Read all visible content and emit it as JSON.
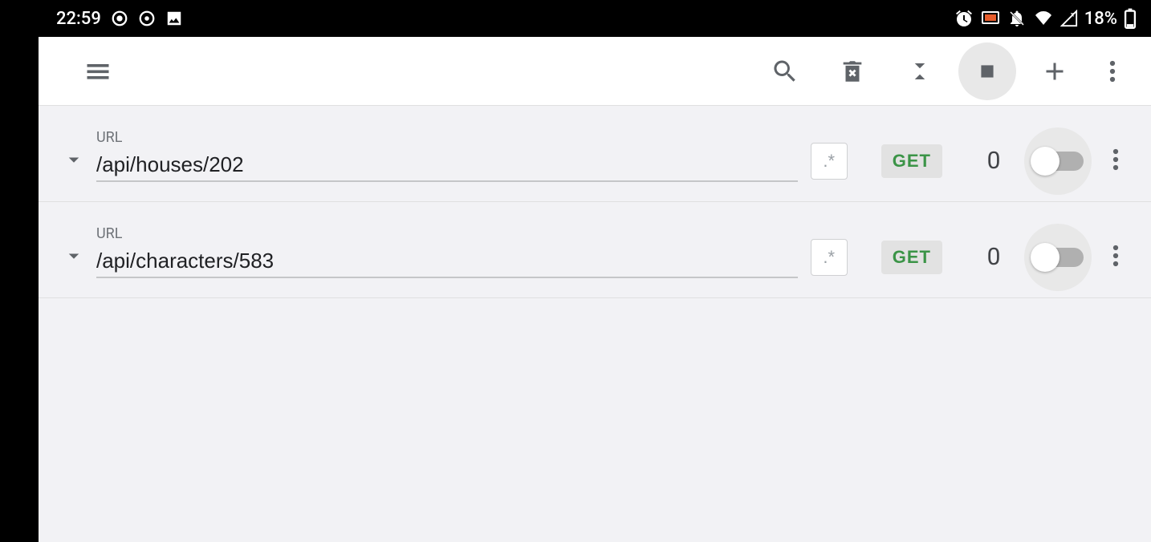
{
  "status_bar": {
    "time": "22:59",
    "battery_text": "18%"
  },
  "app_bar": {
    "icons": {
      "menu": "menu",
      "search": "search",
      "delete": "delete",
      "collapse": "collapse",
      "stop": "stop",
      "add": "add",
      "overflow": "overflow"
    }
  },
  "rows": [
    {
      "label": "URL",
      "url": "/api/houses/202",
      "regex": ".*",
      "method": "GET",
      "count": "0",
      "enabled": false
    },
    {
      "label": "URL",
      "url": "/api/characters/583",
      "regex": ".*",
      "method": "GET",
      "count": "0",
      "enabled": false
    }
  ]
}
